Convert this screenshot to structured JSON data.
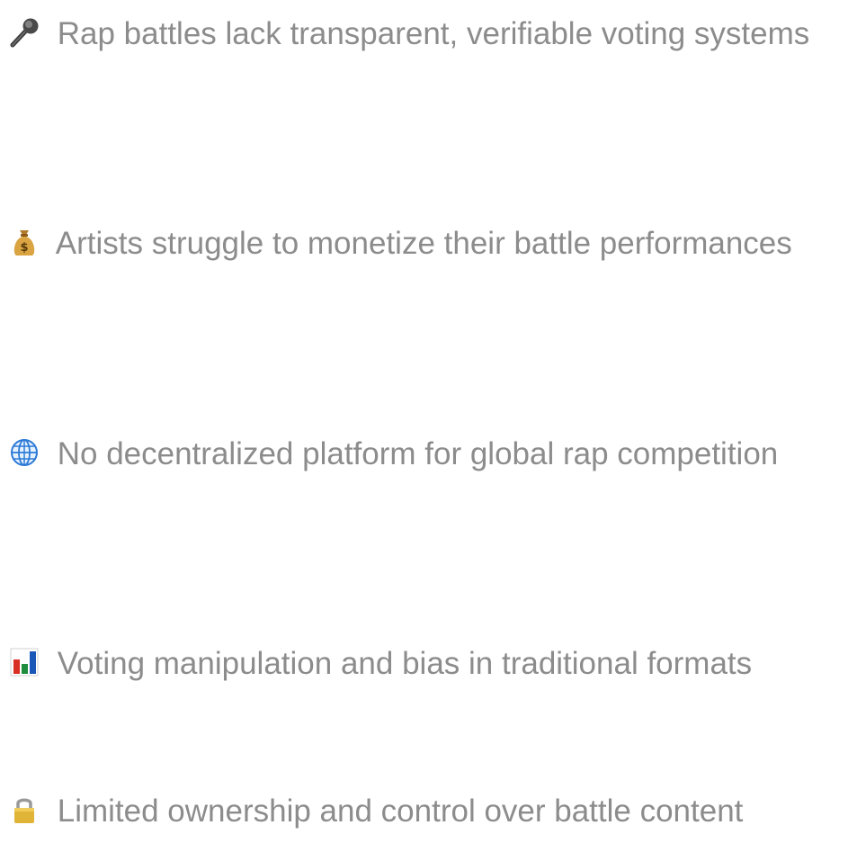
{
  "problems": [
    {
      "icon": "microphone-icon",
      "text": "Rap battles lack transparent, verifiable voting systems"
    },
    {
      "icon": "money-bag-icon",
      "text": "Artists struggle to monetize their battle performances"
    },
    {
      "icon": "globe-icon",
      "text": "No decentralized platform for global rap competition"
    },
    {
      "icon": "bar-chart-icon",
      "text": "Voting manipulation and bias in traditional formats"
    },
    {
      "icon": "lock-icon",
      "text": "Limited ownership and control over battle content"
    }
  ],
  "colors": {
    "text": "#8c8c8c",
    "background": "#ffffff"
  }
}
